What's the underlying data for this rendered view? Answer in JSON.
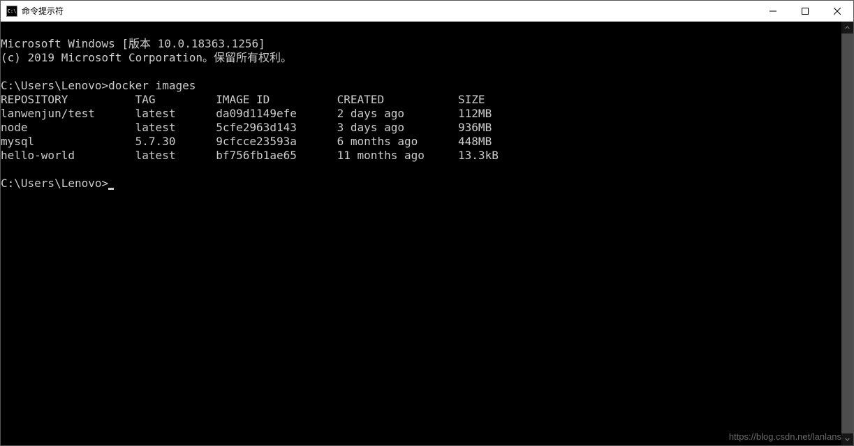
{
  "window": {
    "title": "命令提示符"
  },
  "terminal": {
    "banner_line1": "Microsoft Windows [版本 10.0.18363.1256]",
    "banner_line2": "(c) 2019 Microsoft Corporation。保留所有权利。",
    "prompt1_path": "C:\\Users\\Lenovo>",
    "prompt1_command": "docker images",
    "table_header": {
      "repository": "REPOSITORY",
      "tag": "TAG",
      "image_id": "IMAGE ID",
      "created": "CREATED",
      "size": "SIZE"
    },
    "images": [
      {
        "repository": "lanwenjun/test",
        "tag": "latest",
        "image_id": "da09d1149efe",
        "created": "2 days ago",
        "size": "112MB"
      },
      {
        "repository": "node",
        "tag": "latest",
        "image_id": "5cfe2963d143",
        "created": "3 days ago",
        "size": "936MB"
      },
      {
        "repository": "mysql",
        "tag": "5.7.30",
        "image_id": "9cfcce23593a",
        "created": "6 months ago",
        "size": "448MB"
      },
      {
        "repository": "hello-world",
        "tag": "latest",
        "image_id": "bf756fb1ae65",
        "created": "11 months ago",
        "size": "13.3kB"
      }
    ],
    "prompt2_path": "C:\\Users\\Lenovo>"
  },
  "watermark": "https://blog.csdn.net/lanlans"
}
